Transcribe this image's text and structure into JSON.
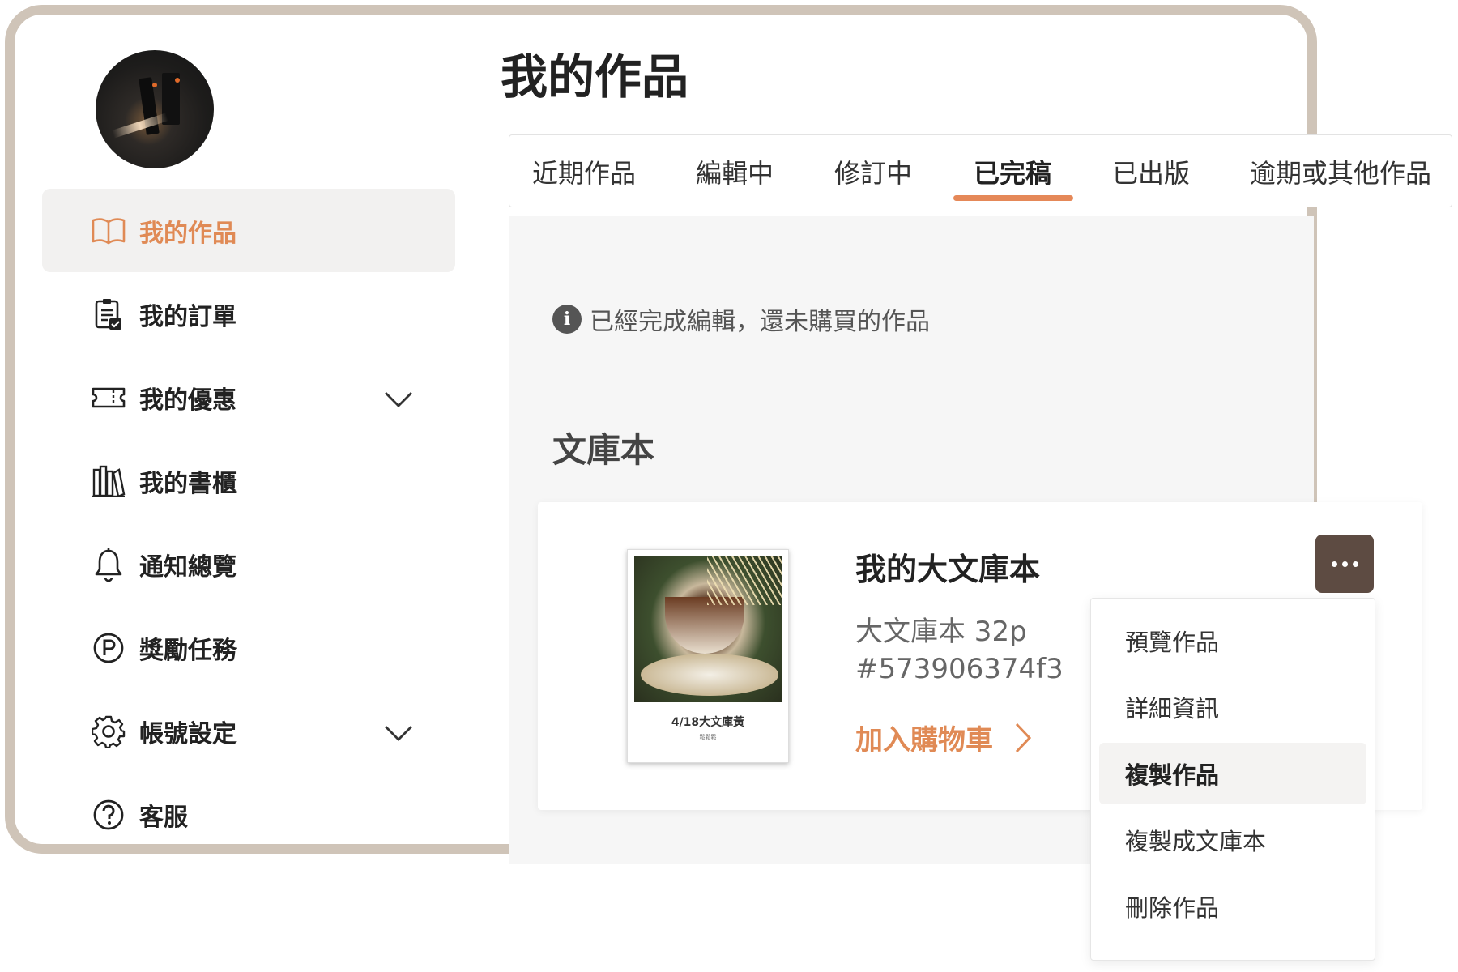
{
  "page": {
    "title": "我的作品"
  },
  "sidebar": {
    "items": [
      {
        "label": "我的作品",
        "icon": "book-open-icon",
        "active": true
      },
      {
        "label": "我的訂單",
        "icon": "order-icon"
      },
      {
        "label": "我的優惠",
        "icon": "ticket-icon",
        "expandable": true
      },
      {
        "label": "我的書櫃",
        "icon": "bookshelf-icon"
      },
      {
        "label": "通知總覽",
        "icon": "bell-icon"
      },
      {
        "label": "獎勵任務",
        "icon": "points-icon"
      },
      {
        "label": "帳號設定",
        "icon": "gear-icon",
        "expandable": true
      },
      {
        "label": "客服",
        "icon": "help-icon"
      }
    ]
  },
  "tabs": [
    {
      "label": "近期作品"
    },
    {
      "label": "編輯中"
    },
    {
      "label": "修訂中"
    },
    {
      "label": "已完稿",
      "active": true
    },
    {
      "label": "已出版"
    },
    {
      "label": "逾期或其他作品"
    }
  ],
  "info": {
    "text": "已經完成編輯，還未購買的作品",
    "icon": "info-icon"
  },
  "section": {
    "title": "文庫本"
  },
  "work": {
    "title": "我的大文庫本",
    "spec": "大文庫本 32p",
    "id": "#573906374f3",
    "add_to_cart": "加入購物車",
    "cover_caption": "4/18大文庫黃",
    "cover_sub": "鬆鬆鬆"
  },
  "menu": {
    "items": [
      {
        "label": "預覽作品"
      },
      {
        "label": "詳細資訊"
      },
      {
        "label": "複製作品",
        "highlighted": true
      },
      {
        "label": "複製成文庫本"
      },
      {
        "label": "刪除作品"
      }
    ]
  },
  "colors": {
    "accent": "#e08a55",
    "frame": "#cfc4b8",
    "more_button": "#5d4b42",
    "panel": "#f6f6f6"
  }
}
